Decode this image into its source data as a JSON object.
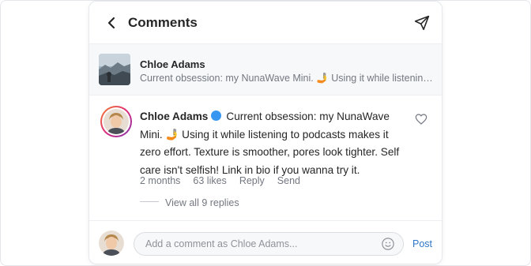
{
  "header": {
    "title": "Comments"
  },
  "preview": {
    "author": "Chloe Adams",
    "caption": "Current obsession: my NunaWave Mini. 🤳 Using it while listening to podcasts makes it zero effort. Texture is smoother, pores look tighter. Self care isn't selfish! Link in bio if you wanna try it."
  },
  "comment": {
    "author": "Chloe Adams",
    "text": "Current obsession: my NunaWave Mini. 🤳 Using it while listening to podcasts makes it zero effort. Texture is smoother, pores look tighter. Self care isn't selfish! Link in bio if you wanna try it.",
    "time": "2 months",
    "likes": "63 likes",
    "reply_label": "Reply",
    "send_label": "Send",
    "view_replies": "View all 9 replies"
  },
  "footer": {
    "placeholder": "Add a comment as Chloe Adams...",
    "post_label": "Post"
  },
  "colors": {
    "verified": "#3897f0",
    "post": "#2d76c8",
    "muted_text": "#737780"
  },
  "icons": [
    "chevron-left-icon",
    "send-icon",
    "verified-icon",
    "heart-icon",
    "emoji-icon"
  ]
}
